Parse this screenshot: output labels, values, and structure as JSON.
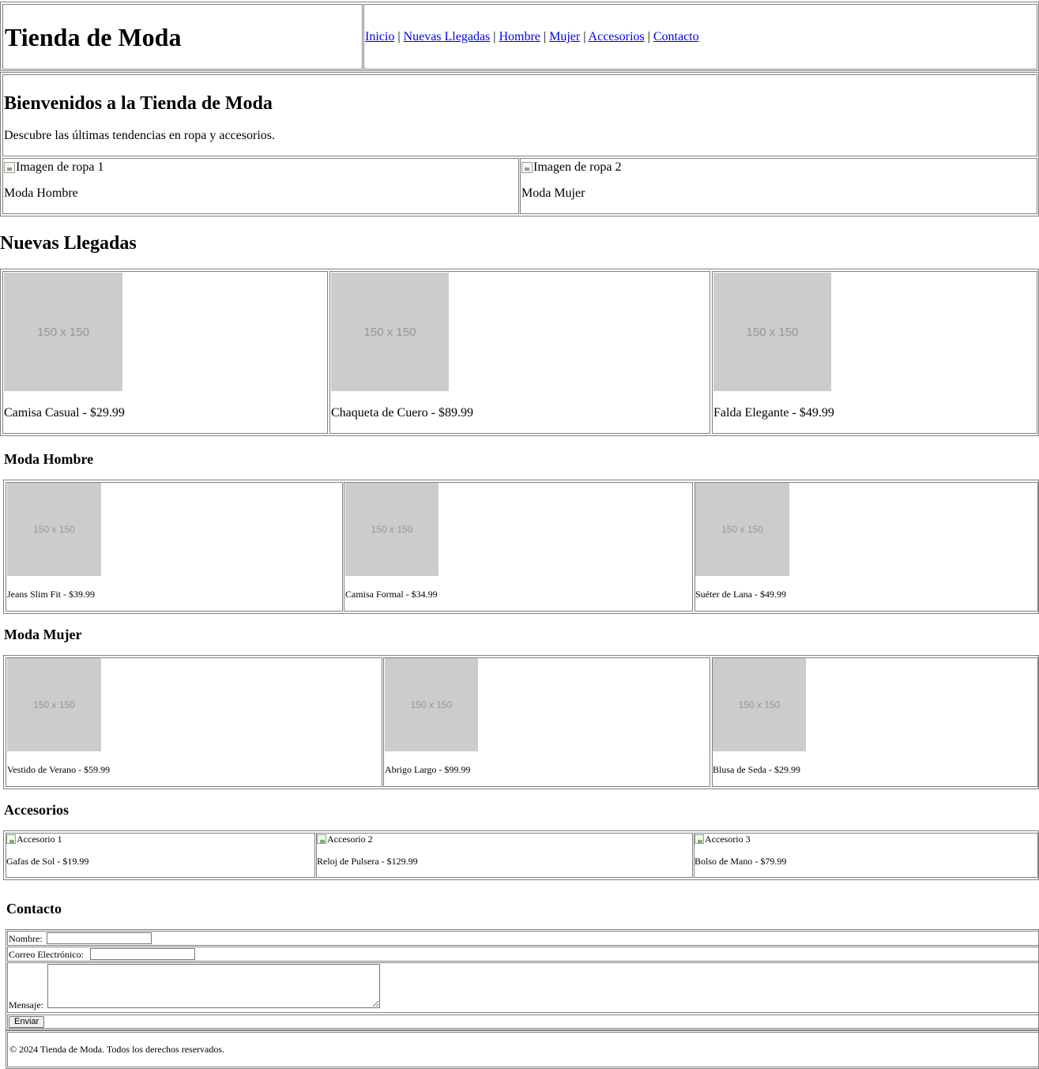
{
  "header": {
    "title": "Tienda de Moda",
    "nav": [
      {
        "label": "Inicio"
      },
      {
        "label": "Nuevas Llegadas"
      },
      {
        "label": "Hombre"
      },
      {
        "label": "Mujer"
      },
      {
        "label": "Accesorios"
      },
      {
        "label": "Contacto"
      }
    ],
    "separator": "|"
  },
  "welcome": {
    "title": "Bienvenidos a la Tienda de Moda",
    "text": "Descubre las últimas tendencias en ropa y accesorios."
  },
  "promo": [
    {
      "alt": "Imagen de ropa 1",
      "label": "Moda Hombre"
    },
    {
      "alt": "Imagen de ropa 2",
      "label": "Moda Mujer"
    }
  ],
  "new_arrivals": {
    "title": "Nuevas Llegadas",
    "items": [
      {
        "placeholder": "150 x 150",
        "label": "Camisa Casual - $29.99"
      },
      {
        "placeholder": "150 x 150",
        "label": "Chaqueta de Cuero - $89.99"
      },
      {
        "placeholder": "150 x 150",
        "label": "Falda Elegante - $49.99"
      }
    ]
  },
  "men": {
    "title": "Moda Hombre",
    "items": [
      {
        "placeholder": "150 x 150",
        "label": "Jeans Slim Fit - $39.99"
      },
      {
        "placeholder": "150 x 150",
        "label": "Camisa Formal - $34.99"
      },
      {
        "placeholder": "150 x 150",
        "label": "Suéter de Lana - $49.99"
      }
    ]
  },
  "women": {
    "title": "Moda Mujer",
    "items": [
      {
        "placeholder": "150 x 150",
        "label": "Vestido de Verano - $59.99"
      },
      {
        "placeholder": "150 x 150",
        "label": "Abrigo Largo - $99.99"
      },
      {
        "placeholder": "150 x 150",
        "label": "Blusa de Seda - $29.99"
      }
    ]
  },
  "accessories": {
    "title": "Accesorios",
    "items": [
      {
        "alt": "Accesorio 1",
        "label": "Gafas de Sol - $19.99"
      },
      {
        "alt": "Accesorio 2",
        "label": "Reloj de Pulsera - $129.99"
      },
      {
        "alt": "Accesorio 3",
        "label": "Bolso de Mano - $79.99"
      }
    ]
  },
  "contact": {
    "title": "Contacto",
    "name_label": "Nombre:",
    "name_value": "",
    "email_label": "Correo Electrónico:",
    "email_value": "",
    "message_label": "Mensaje:",
    "message_value": "",
    "submit_label": "Enviar"
  },
  "footer": {
    "text": "© 2024 Tienda de Moda. Todos los derechos reservados."
  },
  "colors": {
    "link": "#0000ee",
    "placeholder_bg": "#cccccc",
    "placeholder_text": "#969696",
    "border": "#808080"
  }
}
